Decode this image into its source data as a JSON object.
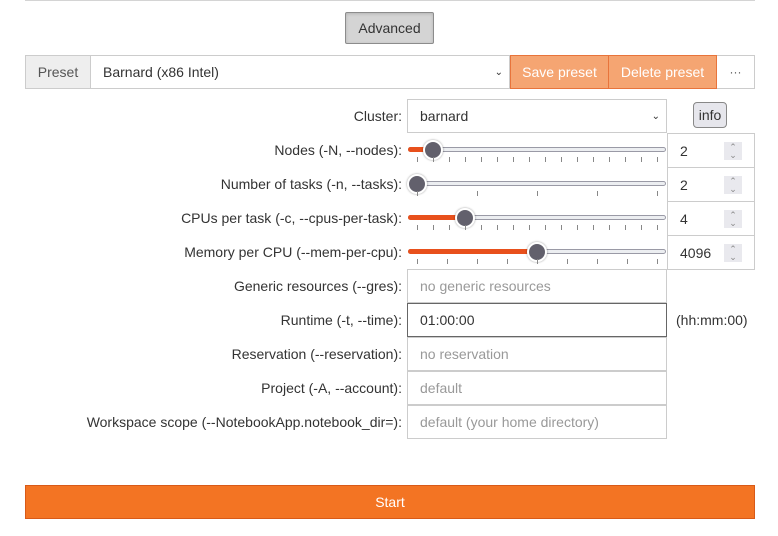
{
  "advanced_label": "Advanced",
  "preset": {
    "label": "Preset",
    "selected": "Barnard (x86 Intel)",
    "save_label": "Save preset",
    "delete_label": "Delete preset",
    "more_label": "···"
  },
  "cluster": {
    "label": "Cluster:",
    "selected": "barnard",
    "info_label": "info"
  },
  "sliders": [
    {
      "label": "Nodes (-N, --nodes):",
      "value": "2",
      "fraction": 0.0667,
      "ticks": 16
    },
    {
      "label": "Number of tasks (-n, --tasks):",
      "value": "2",
      "fraction": 0.0,
      "ticks": 5
    },
    {
      "label": "CPUs per task (-c, --cpus-per-task):",
      "value": "4",
      "fraction": 0.2,
      "ticks": 16
    },
    {
      "label": "Memory per CPU (--mem-per-cpu):",
      "value": "4096",
      "fraction": 0.5,
      "ticks": 9
    }
  ],
  "text_fields": [
    {
      "label": "Generic resources (--gres):",
      "value": "",
      "placeholder": "no generic resources"
    },
    {
      "label": "Runtime (-t, --time):",
      "value": "01:00:00",
      "placeholder": "",
      "hint": "(hh:mm:00)"
    },
    {
      "label": "Reservation (--reservation):",
      "value": "",
      "placeholder": "no reservation"
    },
    {
      "label": "Project (-A, --account):",
      "value": "",
      "placeholder": "default"
    },
    {
      "label": "Workspace scope (--NotebookApp.notebook_dir=):",
      "value": "",
      "placeholder": "default (your home directory)"
    }
  ],
  "start_label": "Start",
  "colors": {
    "accent": "#f37423",
    "slider_fill": "#e8501c",
    "preset_button": "#f5a572"
  }
}
